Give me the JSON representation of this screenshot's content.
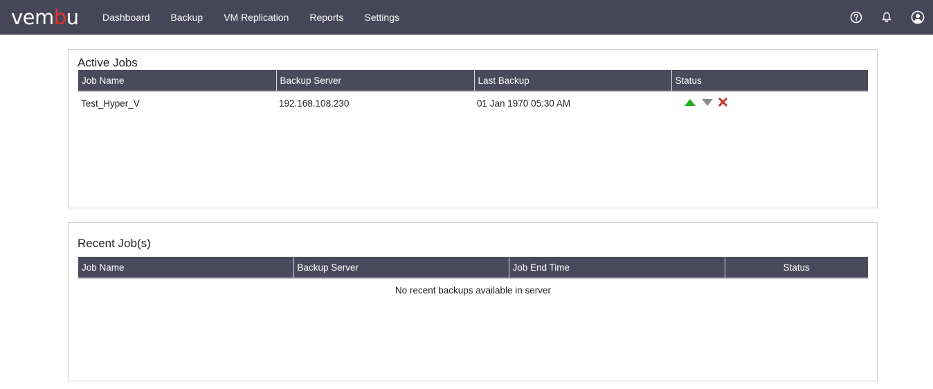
{
  "brand": {
    "logo_text_start": "vem",
    "logo_text_accent": "b",
    "logo_text_end": "u",
    "accent_color": "#e8332a",
    "nav_bg": "#464658"
  },
  "nav": {
    "items": [
      "Dashboard",
      "Backup",
      "VM Replication",
      "Reports",
      "Settings"
    ],
    "icons": [
      "help-icon",
      "bell-icon",
      "user-icon"
    ]
  },
  "active_jobs": {
    "title": "Active Jobs",
    "columns": [
      "Job Name",
      "Backup Server",
      "Last Backup",
      "Status"
    ],
    "rows": [
      {
        "job_name": "Test_Hyper_V",
        "backup_server": "192.168.108.230",
        "last_backup": "01 Jan 1970 05:30 AM",
        "status_icons": [
          "arrow-up-green-icon",
          "arrow-down-gray-icon",
          "close-red-icon"
        ]
      }
    ]
  },
  "recent_jobs": {
    "title": "Recent Job(s)",
    "columns": [
      "Job Name",
      "Backup Server",
      "Job End Time",
      "Status"
    ],
    "empty_message": "No recent backups available in server"
  }
}
